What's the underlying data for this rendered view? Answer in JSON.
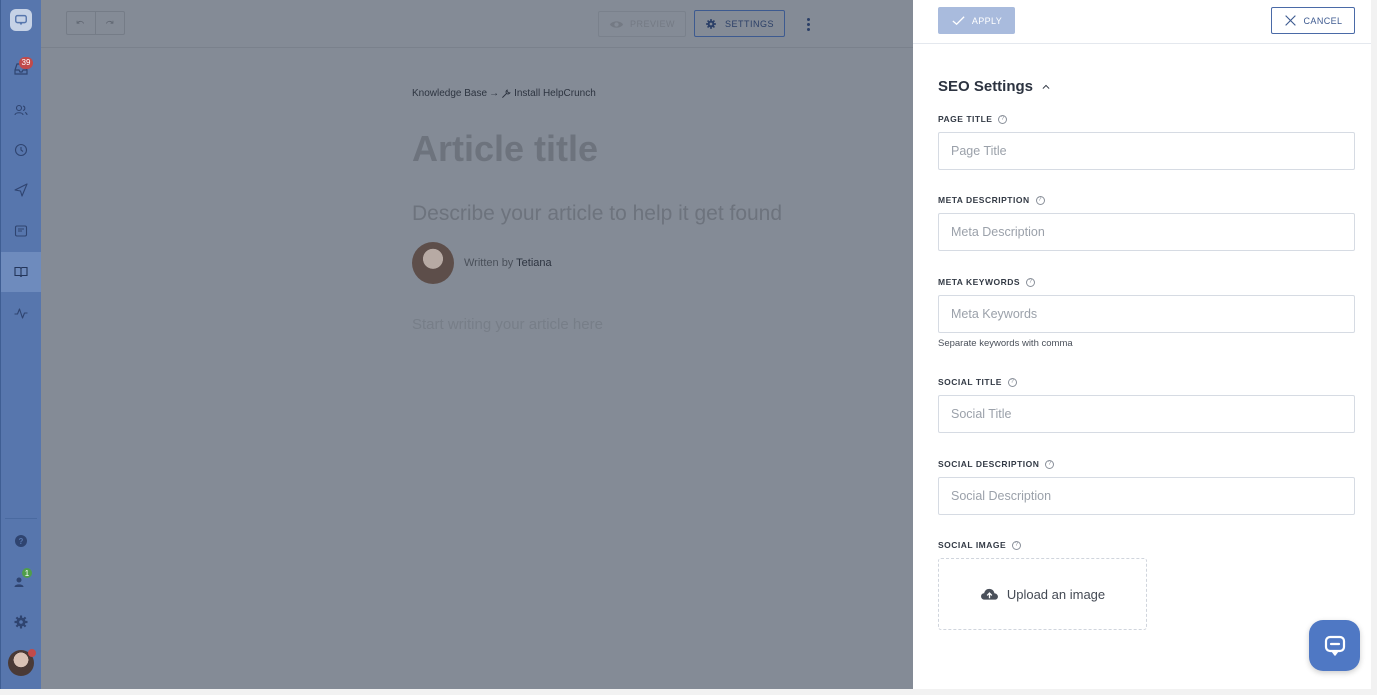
{
  "sidebar": {
    "inbox_badge": "39",
    "team_badge": "1",
    "items": [
      {
        "name": "inbox"
      },
      {
        "name": "contacts"
      },
      {
        "name": "history"
      },
      {
        "name": "messages"
      },
      {
        "name": "widget"
      },
      {
        "name": "knowledge-base",
        "active": true
      },
      {
        "name": "activity"
      },
      {
        "name": "help"
      },
      {
        "name": "team"
      },
      {
        "name": "settings"
      }
    ]
  },
  "toolbar": {
    "preview_label": "PREVIEW",
    "settings_label": "SETTINGS"
  },
  "article": {
    "breadcrumb_root": "Knowledge Base",
    "breadcrumb_arrow": "→",
    "breadcrumb_category": "Install HelpCrunch",
    "title": "Article title",
    "description": "Describe your article to help it get found",
    "written_by": "Written by",
    "author": "Tetiana",
    "body_placeholder": "Start writing your article here"
  },
  "panel": {
    "apply_label": "APPLY",
    "cancel_label": "CANCEL",
    "section_title": "SEO Settings",
    "fields": {
      "page_title": {
        "label": "PAGE TITLE",
        "placeholder": "Page Title",
        "value": ""
      },
      "meta_description": {
        "label": "META DESCRIPTION",
        "placeholder": "Meta Description",
        "value": ""
      },
      "meta_keywords": {
        "label": "META KEYWORDS",
        "placeholder": "Meta Keywords",
        "value": "",
        "hint": "Separate keywords with comma"
      },
      "social_title": {
        "label": "SOCIAL TITLE",
        "placeholder": "Social Title",
        "value": ""
      },
      "social_description": {
        "label": "SOCIAL DESCRIPTION",
        "placeholder": "Social Description",
        "value": ""
      },
      "social_image": {
        "label": "SOCIAL IMAGE",
        "upload_label": "Upload an image"
      }
    }
  },
  "colors": {
    "sidebar": "#5776ad",
    "overlay": "#848b96",
    "accent": "#4f78c4",
    "apply_disabled": "#a9bbdd",
    "badge_red": "#c14a4a",
    "badge_green": "#4f9e4a"
  }
}
